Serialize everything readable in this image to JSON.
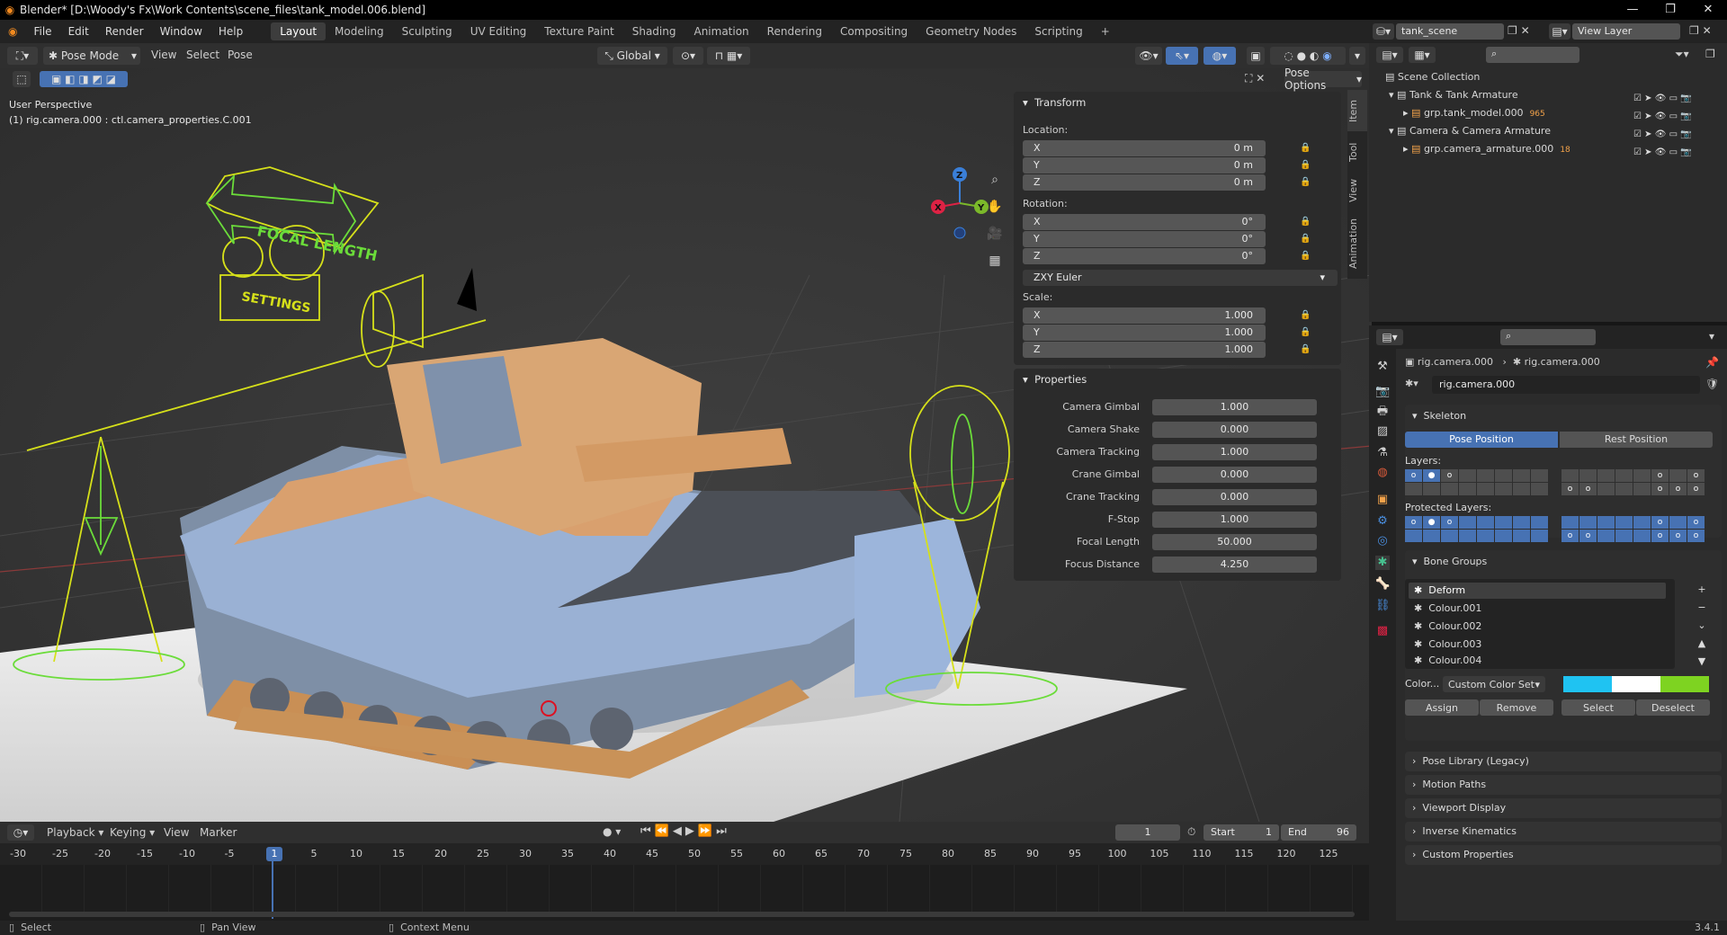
{
  "window": {
    "title": "Blender* [D:\\Woody's Fx\\Work Contents\\scene_files\\tank_model.006.blend]",
    "version": "3.4.1"
  },
  "menu": [
    "File",
    "Edit",
    "Render",
    "Window",
    "Help"
  ],
  "workspaces": [
    "Layout",
    "Modeling",
    "Sculpting",
    "UV Editing",
    "Texture Paint",
    "Shading",
    "Animation",
    "Rendering",
    "Compositing",
    "Geometry Nodes",
    "Scripting"
  ],
  "active_workspace": "Layout",
  "viewport_header": {
    "mode": "Pose Mode",
    "menus": [
      "View",
      "Select",
      "Pose"
    ],
    "transform_orientation": "Global",
    "pose_options": "Pose Options"
  },
  "viewport": {
    "view_name": "User Perspective",
    "active_info": "(1) rig.camera.000 : ctl.camera_properties.C.001"
  },
  "npanel": {
    "tabs": [
      "Item",
      "Tool",
      "View",
      "Animation"
    ],
    "transform": {
      "title": "Transform",
      "location_label": "Location:",
      "location": [
        {
          "axis": "X",
          "value": "0 m"
        },
        {
          "axis": "Y",
          "value": "0 m"
        },
        {
          "axis": "Z",
          "value": "0 m"
        }
      ],
      "rotation_label": "Rotation:",
      "rotation": [
        {
          "axis": "X",
          "value": "0°"
        },
        {
          "axis": "Y",
          "value": "0°"
        },
        {
          "axis": "Z",
          "value": "0°"
        }
      ],
      "rotation_mode": "ZXY Euler",
      "scale_label": "Scale:",
      "scale": [
        {
          "axis": "X",
          "value": "1.000"
        },
        {
          "axis": "Y",
          "value": "1.000"
        },
        {
          "axis": "Z",
          "value": "1.000"
        }
      ]
    },
    "properties": {
      "title": "Properties",
      "items": [
        {
          "label": "Camera Gimbal",
          "value": "1.000"
        },
        {
          "label": "Camera Shake",
          "value": "0.000"
        },
        {
          "label": "Camera Tracking",
          "value": "1.000"
        },
        {
          "label": "Crane Gimbal",
          "value": "0.000"
        },
        {
          "label": "Crane Tracking",
          "value": "0.000"
        },
        {
          "label": "F-Stop",
          "value": "1.000"
        },
        {
          "label": "Focal Length",
          "value": "50.000"
        },
        {
          "label": "Focus Distance",
          "value": "4.250"
        }
      ]
    }
  },
  "rig_labels": {
    "focal": "FOCAL LENGTH",
    "settings": "SETTINGS"
  },
  "outliner": {
    "scene": "tank_scene",
    "view_layer": "View Layer",
    "root": "Scene Collection",
    "items": [
      {
        "name": "Tank & Tank Armature",
        "level": 1
      },
      {
        "name": "grp.tank_model.000",
        "level": 2,
        "badge": "965"
      },
      {
        "name": "Camera & Camera Armature",
        "level": 1
      },
      {
        "name": "grp.camera_armature.000",
        "level": 2,
        "badge": "18"
      }
    ]
  },
  "properties_editor": {
    "breadcrumb": [
      "rig.camera.000",
      "rig.camera.000"
    ],
    "data_name": "rig.camera.000",
    "skeleton": {
      "title": "Skeleton",
      "pose_position": "Pose Position",
      "rest_position": "Rest Position",
      "layers_label": "Layers:",
      "protected_label": "Protected Layers:"
    },
    "bone_groups": {
      "title": "Bone Groups",
      "items": [
        "Deform",
        "Colour.001",
        "Colour.002",
        "Colour.003",
        "Colour.004"
      ],
      "color_label": "Color...",
      "color_set": "Custom Color Set",
      "swatches": [
        "#1fc3f2",
        "#ffffff",
        "#7ed321"
      ],
      "buttons": [
        "Assign",
        "Remove",
        "Select",
        "Deselect"
      ]
    },
    "collapsed": [
      "Pose Library (Legacy)",
      "Motion Paths",
      "Viewport Display",
      "Inverse Kinematics",
      "Custom Properties"
    ]
  },
  "timeline": {
    "menus": [
      "Playback",
      "Keying",
      "View",
      "Marker"
    ],
    "current_frame": "1",
    "start_label": "Start",
    "start": "1",
    "end_label": "End",
    "end": "96",
    "ticks": [
      "-30",
      "-25",
      "-20",
      "-15",
      "-10",
      "-5",
      "1",
      "5",
      "10",
      "15",
      "20",
      "25",
      "30",
      "35",
      "40",
      "45",
      "50",
      "55",
      "60",
      "65",
      "70",
      "75",
      "80",
      "85",
      "90",
      "95",
      "100",
      "105",
      "110",
      "115",
      "120",
      "125"
    ]
  },
  "status": {
    "items": [
      "Select",
      "Pan View",
      "Context Menu"
    ]
  }
}
